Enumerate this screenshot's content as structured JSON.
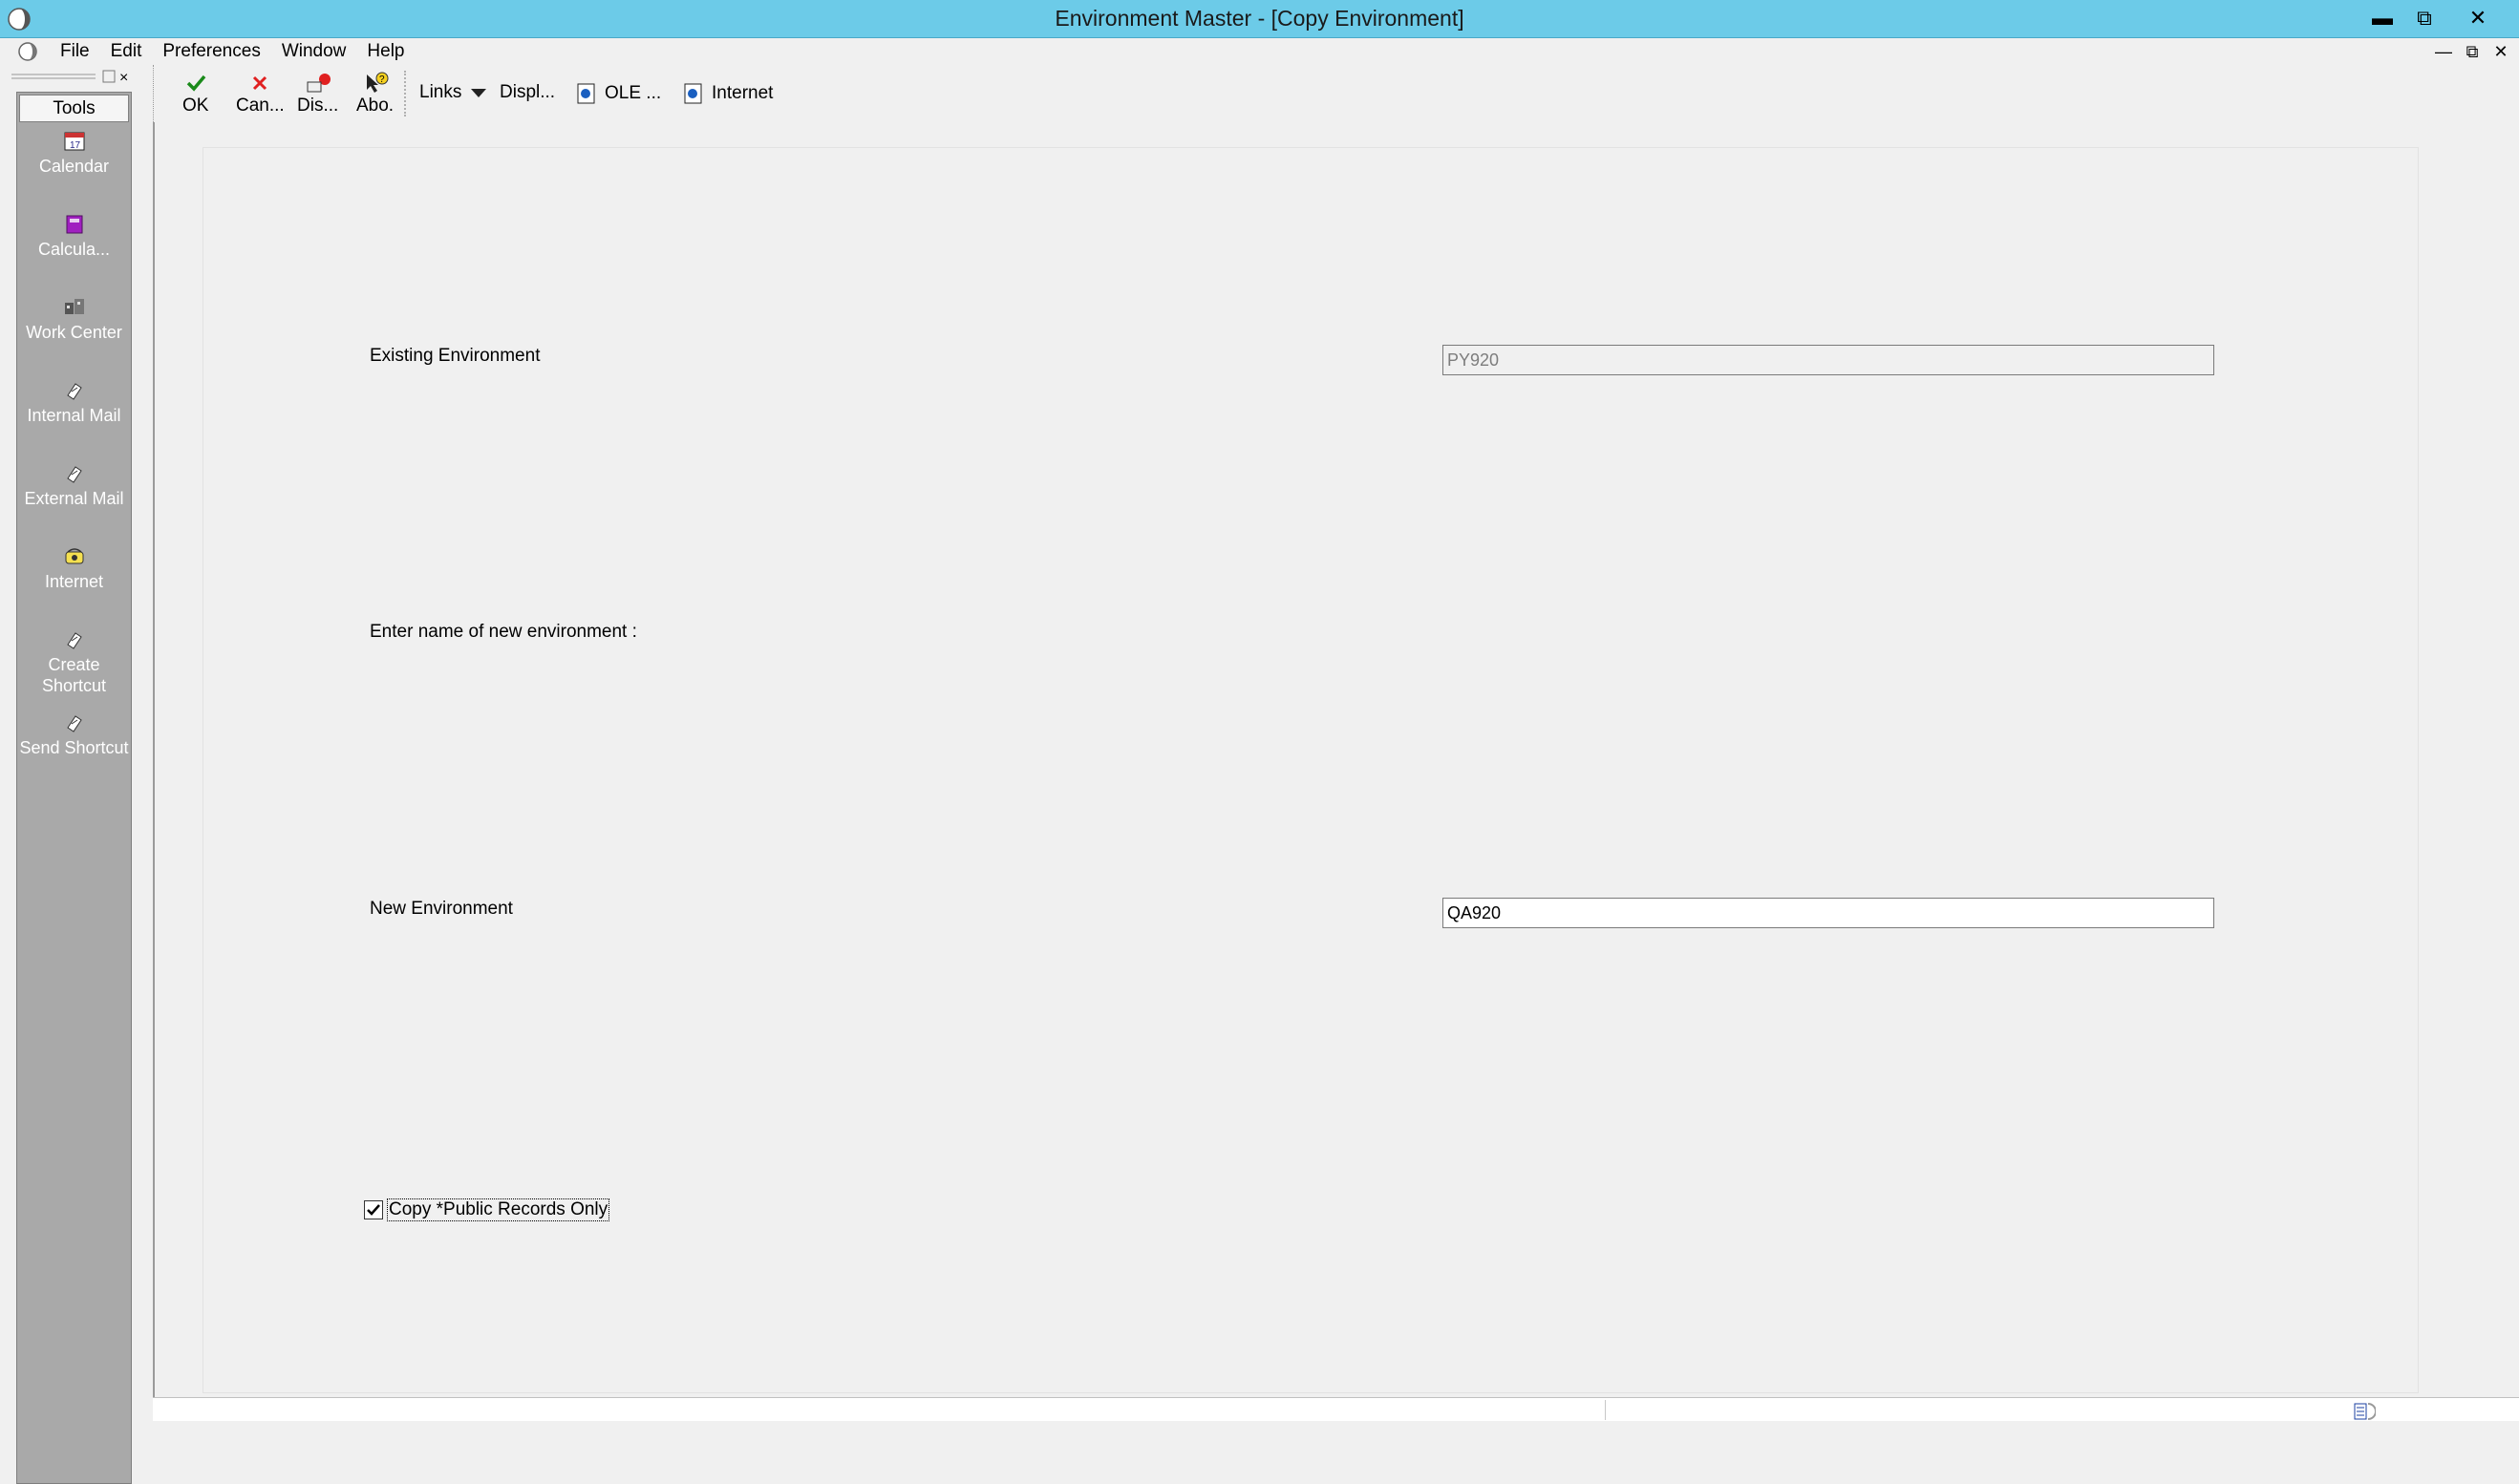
{
  "window": {
    "title": "Environment Master - [Copy Environment]",
    "accent_color": "#6ccbe8"
  },
  "menu": {
    "items": [
      "File",
      "Edit",
      "Preferences",
      "Window",
      "Help"
    ]
  },
  "tools": {
    "header": "Tools",
    "items": [
      {
        "label": "Calendar",
        "icon": "calendar-icon"
      },
      {
        "label": "Calcula...",
        "icon": "calculator-icon"
      },
      {
        "label": "Work Center",
        "icon": "work-center-icon"
      },
      {
        "label": "Internal Mail",
        "icon": "internal-mail-icon"
      },
      {
        "label": "External Mail",
        "icon": "external-mail-icon"
      },
      {
        "label": "Internet",
        "icon": "internet-icon"
      },
      {
        "label": "Create Shortcut",
        "icon": "create-shortcut-icon"
      },
      {
        "label": "Send Shortcut",
        "icon": "send-shortcut-icon"
      }
    ]
  },
  "toolbar": {
    "ok": "OK",
    "cancel": "Can...",
    "display": "Dis...",
    "about": "Abo.",
    "links": "Links",
    "displ": "Displ...",
    "ole": "OLE ...",
    "internet": "Internet"
  },
  "form": {
    "existing_label": "Existing Environment",
    "existing_value": "PY920",
    "prompt_label": "Enter name of new environment :",
    "new_label": "New Environment",
    "new_value": "QA920",
    "copy_public_label": "Copy *Public Records Only",
    "copy_public_checked": true
  }
}
